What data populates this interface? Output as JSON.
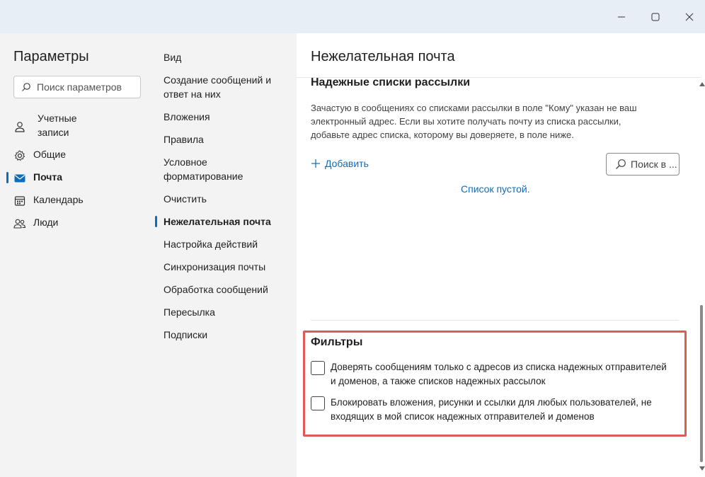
{
  "window": {
    "minimize_icon": "minimize-icon",
    "maximize_icon": "maximize-icon",
    "close_icon": "close-icon"
  },
  "sidebar": {
    "title": "Параметры",
    "search_placeholder": "Поиск параметров",
    "items": [
      {
        "label": "Учетные записи",
        "line1": "Учетные",
        "line2": "записи",
        "icon": "person-icon"
      },
      {
        "label": "Общие",
        "icon": "gear-icon"
      },
      {
        "label": "Почта",
        "icon": "mail-icon",
        "active": true
      },
      {
        "label": "Календарь",
        "icon": "calendar-icon"
      },
      {
        "label": "Люди",
        "icon": "people-icon"
      }
    ]
  },
  "submenu": {
    "items": [
      {
        "line1": "Вид",
        "line2": ""
      },
      {
        "line1": "Создание сообщений и",
        "line2": "ответ на них"
      },
      {
        "line1": "Вложения",
        "line2": ""
      },
      {
        "line1": "Правила",
        "line2": ""
      },
      {
        "line1": "Условное",
        "line2": "форматирование"
      },
      {
        "line1": "Очистить",
        "line2": ""
      },
      {
        "line1": "Нежелательная почта",
        "line2": "",
        "active": true
      },
      {
        "line1": "Настройка действий",
        "line2": ""
      },
      {
        "line1": "Синхронизация почты",
        "line2": ""
      },
      {
        "line1": "Обработка сообщений",
        "line2": ""
      },
      {
        "line1": "Пересылка",
        "line2": ""
      },
      {
        "line1": "Подписки",
        "line2": ""
      }
    ]
  },
  "main": {
    "title": "Нежелательная почта",
    "mailing_lists": {
      "title": "Надежные списки рассылки",
      "desc_line1": "Зачастую в сообщениях со списками рассылки в поле \"Кому\" указан не ваш",
      "desc_line2": "электронный адрес. Если вы хотите получать почту из списка рассылки,",
      "desc_line3": "добавьте адрес списка, которому вы доверяете, в поле ниже.",
      "add_label": "Добавить",
      "search_label": "Поиск в ...",
      "empty_text": "Список пустой."
    },
    "filters": {
      "title": "Фильтры",
      "option1_line1": "Доверять сообщениям только с адресов из списка надежных отправителей",
      "option1_line2": "и доменов, а также списков надежных рассылок",
      "option1_checked": false,
      "option2_line1": "Блокировать вложения, рисунки и ссылки для любых пользователей, не",
      "option2_line2": "входящих в мой список надежных отправителей и доменов",
      "option2_checked": false
    }
  },
  "colors": {
    "accent": "#0f6cbd",
    "highlight_border": "#e05a55",
    "titlebar": "#e8eef6"
  }
}
